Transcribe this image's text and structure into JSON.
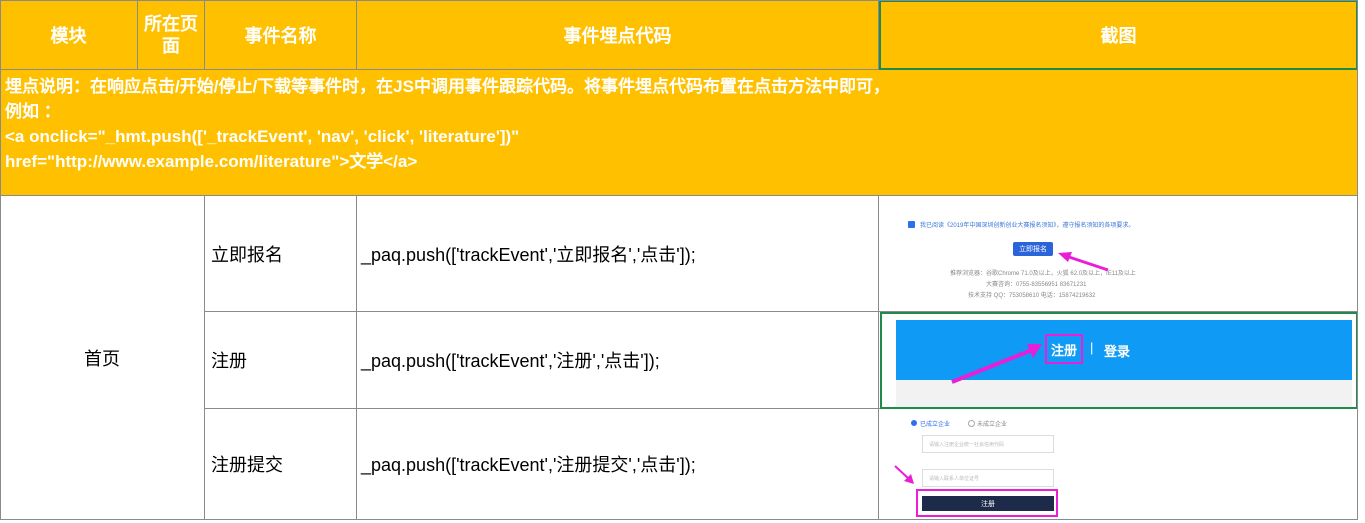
{
  "header": {
    "module": "模块",
    "page_line1": "所在页",
    "page_line2": "面",
    "event_name": "事件名称",
    "event_code": "事件埋点代码",
    "screenshot": "截图"
  },
  "note": {
    "line1": "埋点说明：在响应点击/开始/停止/下载等事件时，在JS中调用事件跟踪代码。将事件埋点代码布置在点击方法中即可，",
    "line2": "例如 ：",
    "line3": "<a onclick=\"_hmt.push(['_trackEvent', 'nav', 'click', 'literature'])\"",
    "line4": "href=\"http://www.example.com/literature\">文学</a>"
  },
  "rows": [
    {
      "name": "立即报名",
      "code": "_paq.push(['trackEvent','立即报名','点击']);"
    },
    {
      "name": "注册",
      "code": "_paq.push(['trackEvent','注册','点击']);"
    },
    {
      "name": "注册提交",
      "code": "_paq.push(['trackEvent','注册提交','点击']);"
    }
  ],
  "module_name": "首页",
  "shots": {
    "s1": {
      "agree": "我已阅读《2019年中国深圳创新创业大赛报名须知》，遵守报名须知的各项要求。",
      "button": "立即报名",
      "browser": "推荐浏览器：谷歌Chrome 71.0及以上，火狐 62.0及以上，IE11及以上",
      "consult": "大赛咨询：0755-83556951  83671231",
      "support": "技术支持 QQ：753058610   电话：15874219632"
    },
    "s2": {
      "register": "注册",
      "separator": "|",
      "login": "登录"
    },
    "s3": {
      "opt1": "已成立企业",
      "opt2": "未成立企业",
      "field1": "请输入注册企业统一社会信用代码",
      "field2": "请输入联系人单位证号",
      "submit": "注册"
    }
  },
  "colors": {
    "header_bg": "#FFC000",
    "header_text": "#FFFFFF",
    "arrow": "#E91ED6",
    "banner": "#0E9AF5"
  }
}
